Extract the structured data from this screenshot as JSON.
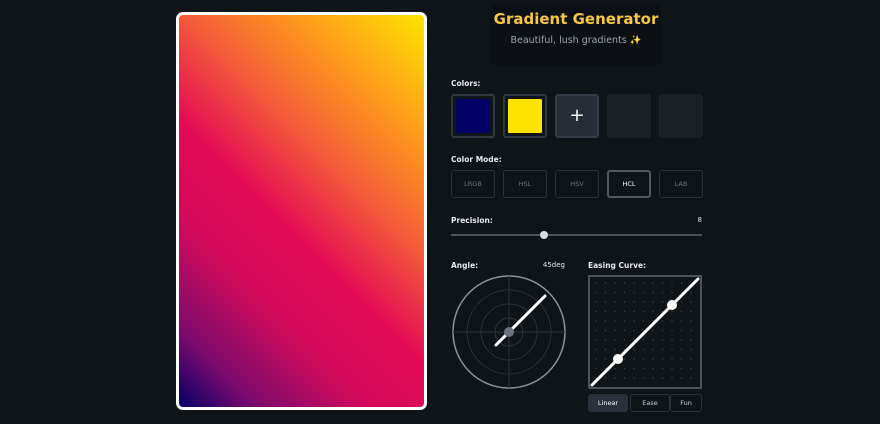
{
  "header": {
    "title": "Gradient Generator",
    "subtitle": "Beautiful, lush gradients ✨"
  },
  "colors": {
    "label": "Colors:",
    "swatches": [
      "#030066",
      "#ffe400"
    ],
    "add_label": "+"
  },
  "color_mode": {
    "label": "Color Mode:",
    "options": [
      "LRGB",
      "HSL",
      "HSV",
      "HCL",
      "LAB"
    ],
    "selected": "HCL"
  },
  "precision": {
    "label": "Precision:",
    "value": "8",
    "level_fraction": 0.37
  },
  "angle": {
    "label": "Angle:",
    "value": "45deg"
  },
  "easing": {
    "label": "Easing Curve:",
    "options": [
      "Linear",
      "Ease",
      "Fun"
    ],
    "selected": "Linear"
  },
  "gradient": {
    "angle_deg": 45,
    "stops": [
      "#030066",
      "#e30a55",
      "#ffe400"
    ]
  }
}
